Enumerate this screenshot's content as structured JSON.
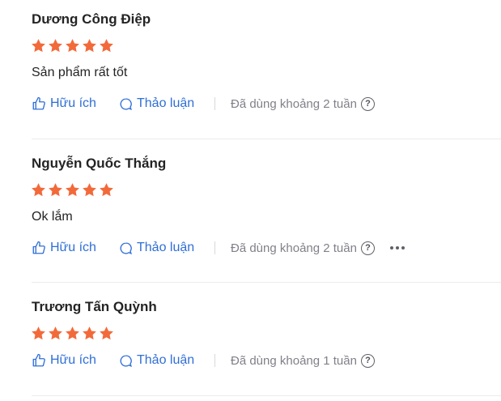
{
  "reviews": [
    {
      "name": "Dương Công Điệp",
      "rating": 5,
      "text": "Sản phẩm rất tốt",
      "like_label": "Hữu ích",
      "discuss_label": "Thảo luận",
      "used_label": "Đã dùng khoảng 2 tuần",
      "help_glyph": "?"
    },
    {
      "name": "Nguyễn Quốc Thắng",
      "rating": 5,
      "text": "Ok lắm",
      "like_label": "Hữu ích",
      "discuss_label": "Thảo luận",
      "used_label": "Đã dùng khoảng 2 tuần",
      "help_glyph": "?"
    },
    {
      "name": "Trương Tấn Quỳnh",
      "rating": 5,
      "text": "",
      "like_label": "Hữu ích",
      "discuss_label": "Thảo luận",
      "used_label": "Đã dùng khoảng 1 tuần",
      "help_glyph": "?"
    }
  ],
  "colors": {
    "star": "#f26a3a",
    "link": "#2f6fd6",
    "muted": "#808089"
  },
  "icons": {
    "like": "thumbs-up-icon",
    "discuss": "chat-bubble-icon",
    "help": "question-circle-icon",
    "more": "more-horizontal-icon",
    "star": "star-icon"
  }
}
